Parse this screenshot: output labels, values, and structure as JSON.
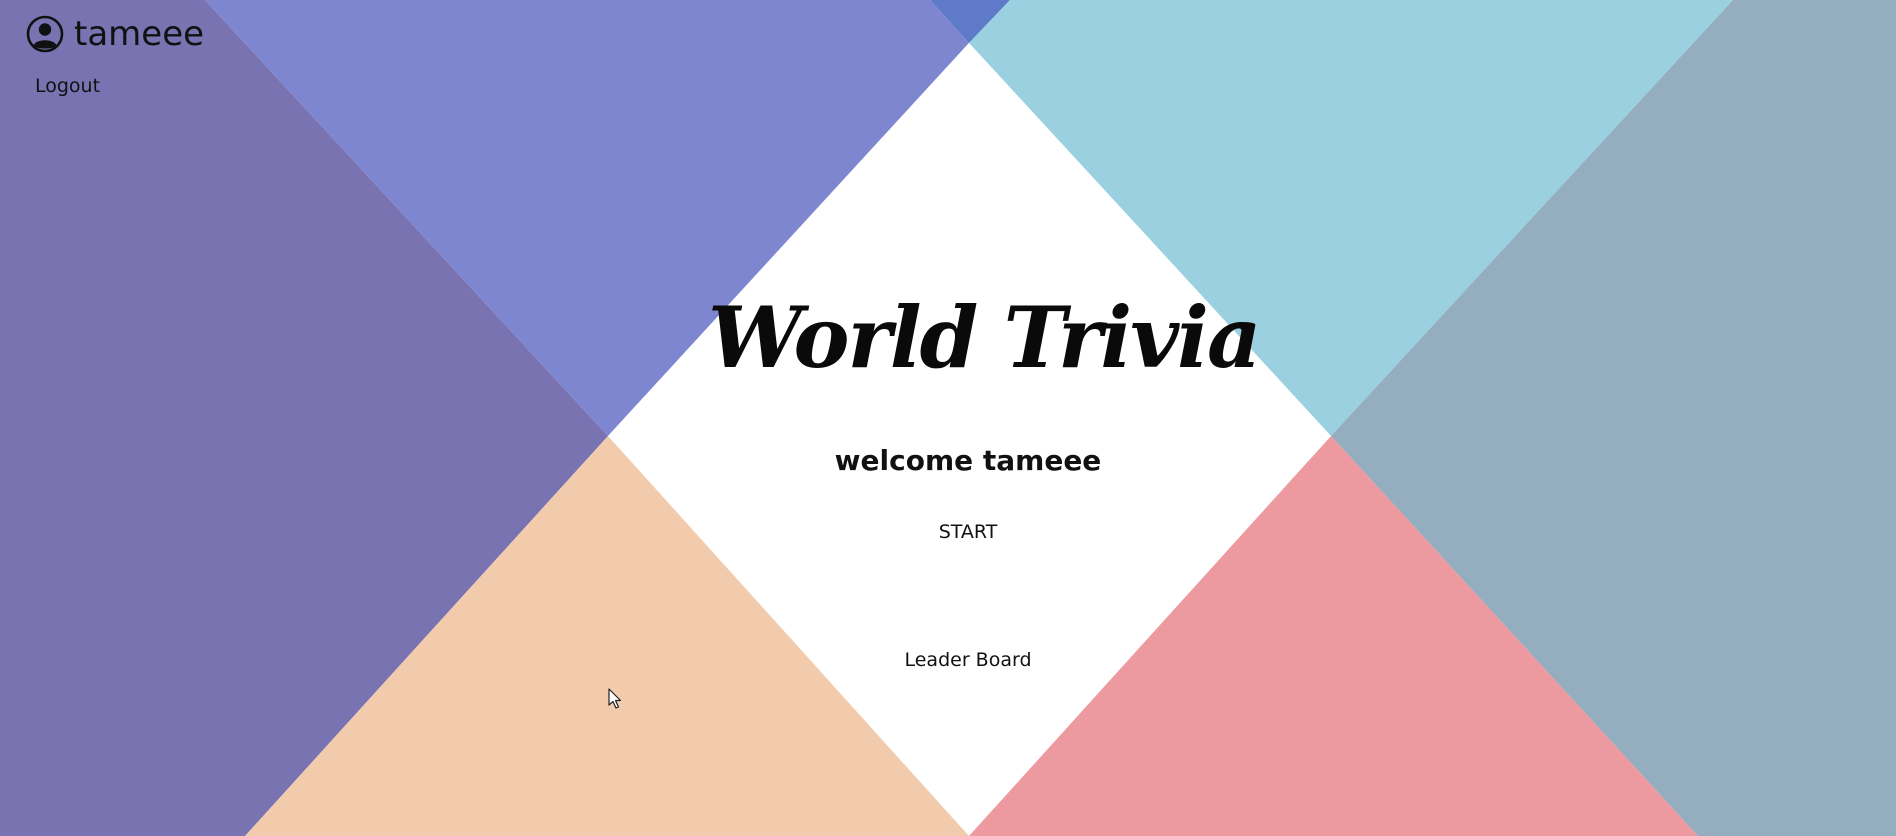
{
  "user": {
    "username": "tameee",
    "icon": "user-circle-icon"
  },
  "nav": {
    "logout_label": "Logout"
  },
  "main": {
    "title": "World Trivia",
    "welcome_text": "welcome tameee",
    "start_label": "START",
    "leaderboard_label": "Leader Board"
  },
  "colors": {
    "left_purple": "#7a73b2",
    "top_left_blue": "#7e86d0",
    "top_sliver": "#5f7ac8",
    "top_right_cyan": "#9ad0e0",
    "right_slate": "#94adbf",
    "bottom_left_peach": "#f2cbad",
    "bottom_right_pink": "#ec9a9f",
    "center_white": "#ffffff"
  }
}
